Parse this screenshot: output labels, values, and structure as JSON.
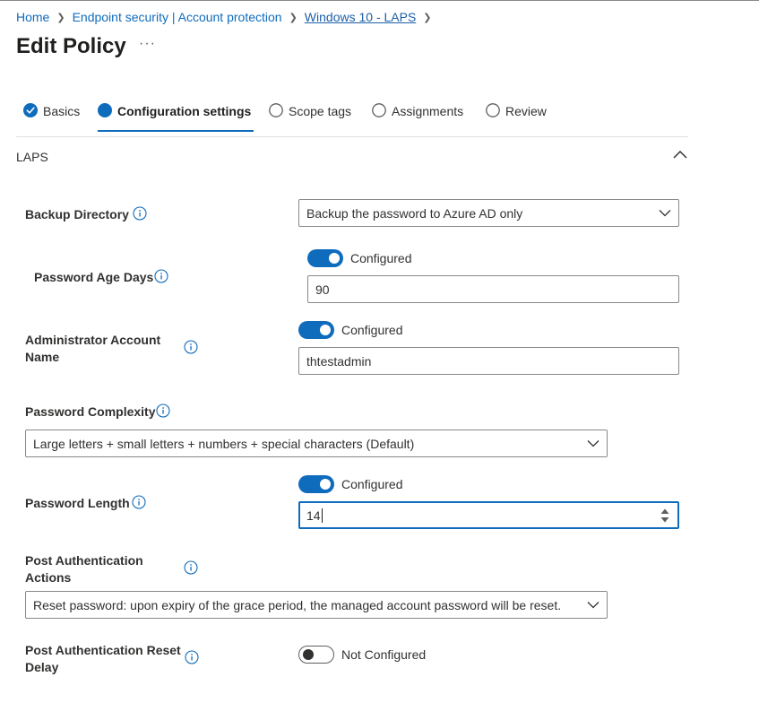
{
  "breadcrumb": {
    "items": [
      "Home",
      "Endpoint security | Account protection",
      "Windows 10 - LAPS"
    ]
  },
  "page": {
    "title": "Edit Policy",
    "more": "···"
  },
  "wizard": {
    "steps": [
      {
        "label": "Basics",
        "state": "completed"
      },
      {
        "label": "Configuration settings",
        "state": "active"
      },
      {
        "label": "Scope tags",
        "state": "pending"
      },
      {
        "label": "Assignments",
        "state": "pending"
      },
      {
        "label": "Review",
        "state": "pending"
      }
    ]
  },
  "section": {
    "title": "LAPS"
  },
  "settings": {
    "backup_directory": {
      "label": "Backup Directory",
      "value": "Backup the password to Azure AD only"
    },
    "password_age_days": {
      "label": "Password Age Days",
      "toggle_label": "Configured",
      "value": "90"
    },
    "admin_account_name": {
      "label_line1": "Administrator Account",
      "label_line2": "Name",
      "toggle_label": "Configured",
      "value": "thtestadmin"
    },
    "password_complexity": {
      "label": "Password Complexity",
      "value": "Large letters + small letters + numbers + special characters (Default)"
    },
    "password_length": {
      "label": "Password Length",
      "toggle_label": "Configured",
      "value": "14"
    },
    "post_auth_actions": {
      "label_line1": "Post Authentication",
      "label_line2": "Actions",
      "value": "Reset password: upon expiry of the grace period, the managed account password will be reset."
    },
    "post_auth_reset_delay": {
      "label_line1": "Post Authentication Reset",
      "label_line2": "Delay",
      "toggle_label": "Not Configured"
    }
  },
  "colors": {
    "accent": "#0f6cbd",
    "border": "#8a8886",
    "text": "#323130"
  }
}
